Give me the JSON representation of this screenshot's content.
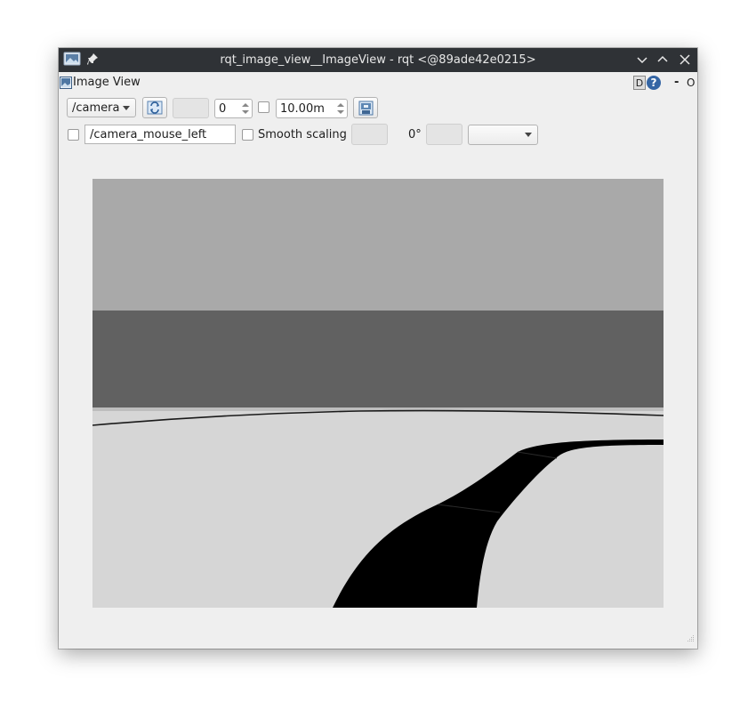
{
  "window": {
    "title": "rqt_image_view__ImageView - rqt <@89ade42e0215>"
  },
  "dock": {
    "title": "Image View",
    "help_d": "D",
    "help_q": "?",
    "minimize_label": "-",
    "close_label": "O"
  },
  "toolbar": {
    "topic_value": "/camera",
    "refresh_icon": "refresh-icon",
    "spin_value": "0",
    "duration_value": "10.00m",
    "save_icon": "save-image-icon"
  },
  "options": {
    "mouse_topic_value": "/camera_mouse_left",
    "smooth_scaling_label": "Smooth scaling",
    "rotation_label": "0°"
  },
  "colors": {
    "titlebar": "#2f3236",
    "window_bg": "#efefef",
    "sky": "#a9a9a9",
    "wall": "#616161",
    "floor": "#d6d6d6",
    "track": "#000000"
  }
}
